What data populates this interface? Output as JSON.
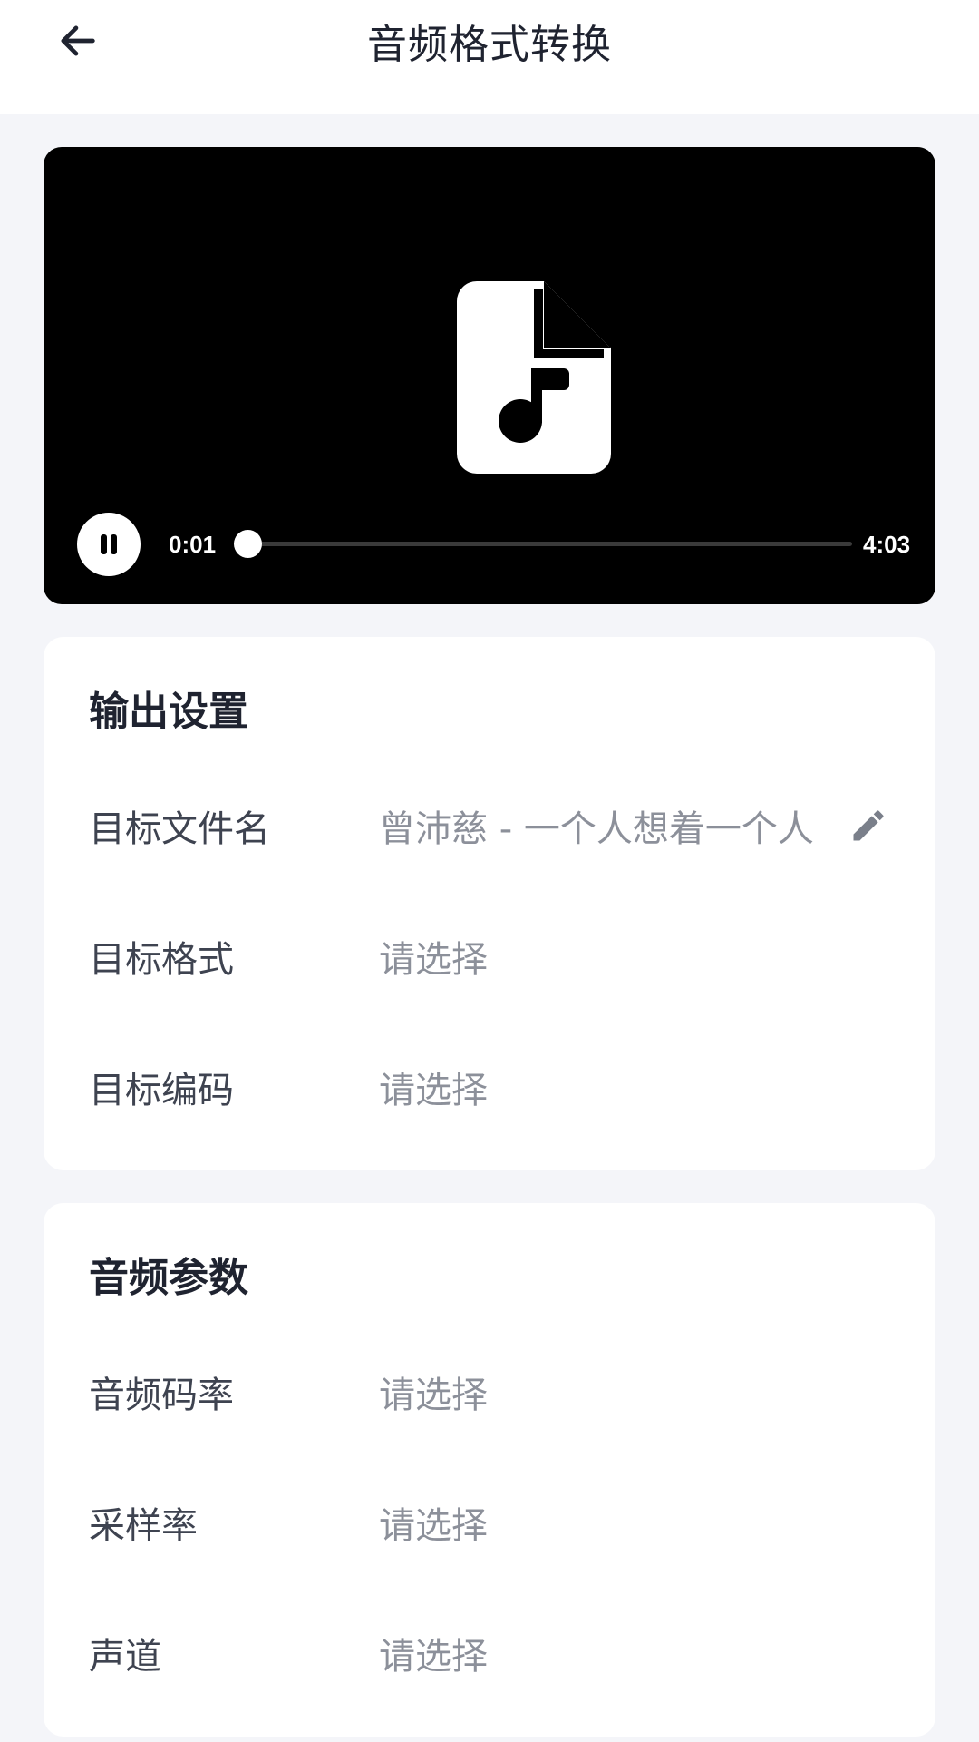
{
  "header": {
    "title": "音频格式转换",
    "back_icon": "arrow-left-icon"
  },
  "player": {
    "file_icon": "audio-file-icon",
    "play_state_icon": "pause-icon",
    "current_time": "0:01",
    "total_time": "4:03",
    "progress_fraction": 0.004
  },
  "output_settings": {
    "title": "输出设置",
    "rows": [
      {
        "label": "目标文件名",
        "value": "曾沛慈 - 一个人想着一个人",
        "icon": "pencil-icon"
      },
      {
        "label": "目标格式",
        "value": "请选择"
      },
      {
        "label": "目标编码",
        "value": "请选择"
      }
    ]
  },
  "audio_params": {
    "title": "音频参数",
    "rows": [
      {
        "label": "音频码率",
        "value": "请选择"
      },
      {
        "label": "采样率",
        "value": "请选择"
      },
      {
        "label": "声道",
        "value": "请选择"
      }
    ]
  },
  "colors": {
    "background": "#f4f5f9",
    "card": "#ffffff",
    "player_bg": "#000000",
    "label": "#3e4350",
    "placeholder": "#8c909a",
    "title": "#1f2330"
  }
}
